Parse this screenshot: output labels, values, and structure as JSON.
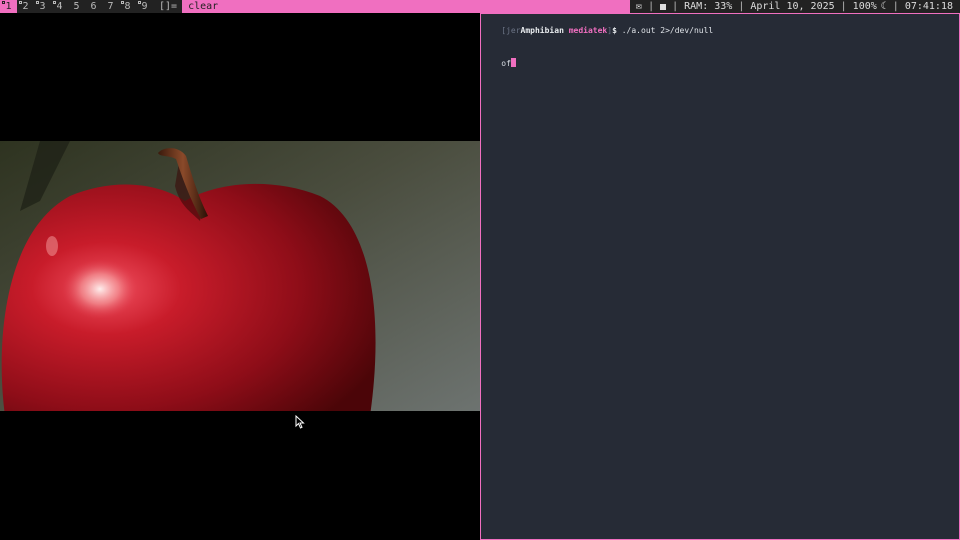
{
  "bar": {
    "tags": [
      {
        "label": "1",
        "selected": true,
        "occupied": true
      },
      {
        "label": "2",
        "selected": false,
        "occupied": true
      },
      {
        "label": "3",
        "selected": false,
        "occupied": true
      },
      {
        "label": "4",
        "selected": false,
        "occupied": true
      },
      {
        "label": "5",
        "selected": false,
        "occupied": false
      },
      {
        "label": "6",
        "selected": false,
        "occupied": false
      },
      {
        "label": "7",
        "selected": false,
        "occupied": false
      },
      {
        "label": "8",
        "selected": false,
        "occupied": true
      },
      {
        "label": "9",
        "selected": false,
        "occupied": true
      }
    ],
    "layout_symbol": "[]=",
    "window_title": "clear",
    "status": {
      "mail_icon": "✉",
      "stop_icon": "stop-square",
      "ram": "RAM: 33%",
      "date": "April 10, 2025",
      "brightness": "100%",
      "moon_icon": "☾",
      "time": "07:41:18"
    },
    "accent_color": "#f06fc0"
  },
  "terminal": {
    "prompt_user": "[jer",
    "prompt_host": "Amphibian",
    "prompt_dir": "mediatek",
    "prompt_close": "]",
    "prompt_dollar": "$",
    "command": "./a.out 2>/dev/null",
    "output_line": "of",
    "background": "#262b36"
  },
  "viewer": {
    "image_subject": "red-apple-photo"
  }
}
